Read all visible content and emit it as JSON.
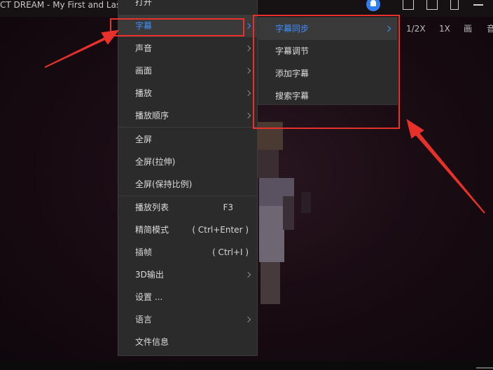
{
  "titlebar": {
    "title": "CT DREAM - My First and Las",
    "icons": [
      "bell-icon",
      "subtitle-window-icon",
      "screenshot-icon",
      "mini-mode-icon",
      "minimize-icon"
    ]
  },
  "toolbar": {
    "items": [
      "1/2X",
      "1X",
      "画",
      "音"
    ]
  },
  "main_menu": {
    "items": [
      {
        "label": "打开",
        "accel": "",
        "submenu": false
      },
      {
        "label": "字幕",
        "accel": "",
        "submenu": true,
        "active": true
      },
      {
        "label": "声音",
        "accel": "",
        "submenu": true
      },
      {
        "label": "画面",
        "accel": "",
        "submenu": true
      },
      {
        "label": "播放",
        "accel": "",
        "submenu": true
      },
      {
        "label": "播放顺序",
        "accel": "",
        "submenu": true
      },
      {
        "label": "全屏",
        "accel": "",
        "submenu": false
      },
      {
        "label": "全屏(拉伸)",
        "accel": "",
        "submenu": false
      },
      {
        "label": "全屏(保持比例)",
        "accel": "",
        "submenu": false
      },
      {
        "label": "播放列表",
        "accel": "F3",
        "submenu": false
      },
      {
        "label": "精简模式",
        "accel": "( Ctrl+Enter )",
        "submenu": false
      },
      {
        "label": "插帧",
        "accel": "( Ctrl+I )",
        "submenu": false
      },
      {
        "label": "3D输出",
        "accel": "",
        "submenu": true
      },
      {
        "label": "设置 ...",
        "accel": "",
        "submenu": false
      },
      {
        "label": "语言",
        "accel": "",
        "submenu": true
      },
      {
        "label": "文件信息",
        "accel": "",
        "submenu": false
      }
    ]
  },
  "sub_menu": {
    "items": [
      {
        "label": "字幕同步",
        "submenu": true,
        "active": true
      },
      {
        "label": "字幕调节",
        "submenu": false
      },
      {
        "label": "添加字幕",
        "submenu": false
      },
      {
        "label": "搜索字幕",
        "submenu": false
      }
    ]
  },
  "colors": {
    "menu_bg": "#2b2b2b",
    "highlight_text": "#3d8fff",
    "annotation_red": "#e8312a",
    "bell_blue": "#2f7ff2"
  }
}
